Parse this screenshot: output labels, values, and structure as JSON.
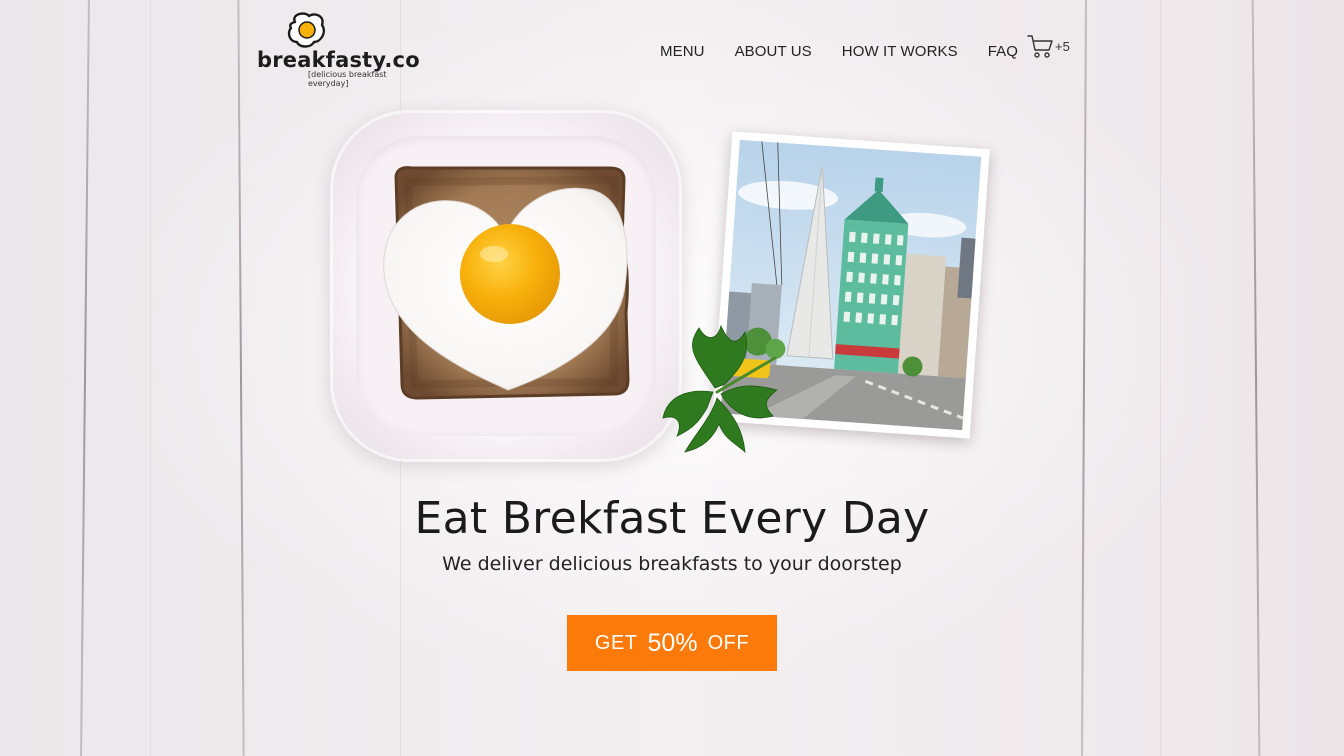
{
  "brand": {
    "name": "breakfasty.co",
    "tagline": "[delicious breakfast everyday]"
  },
  "nav": {
    "items": [
      {
        "label": "MENU"
      },
      {
        "label": "ABOUT US"
      },
      {
        "label": "HOW IT WORKS"
      },
      {
        "label": "FAQ"
      }
    ],
    "cart_count": "+5"
  },
  "hero": {
    "title": "Eat Brekfast Every Day",
    "subtitle": "We deliver delicious breakfasts to your doorstep",
    "cta_prefix": "GET",
    "cta_amount": "50%",
    "cta_suffix": "OFF"
  },
  "icons": {
    "logo": "fried-egg-icon",
    "cart": "shopping-cart-icon"
  },
  "colors": {
    "accent": "#fb7a09",
    "yolk": "#f8b10b",
    "text": "#1b1b1b"
  }
}
